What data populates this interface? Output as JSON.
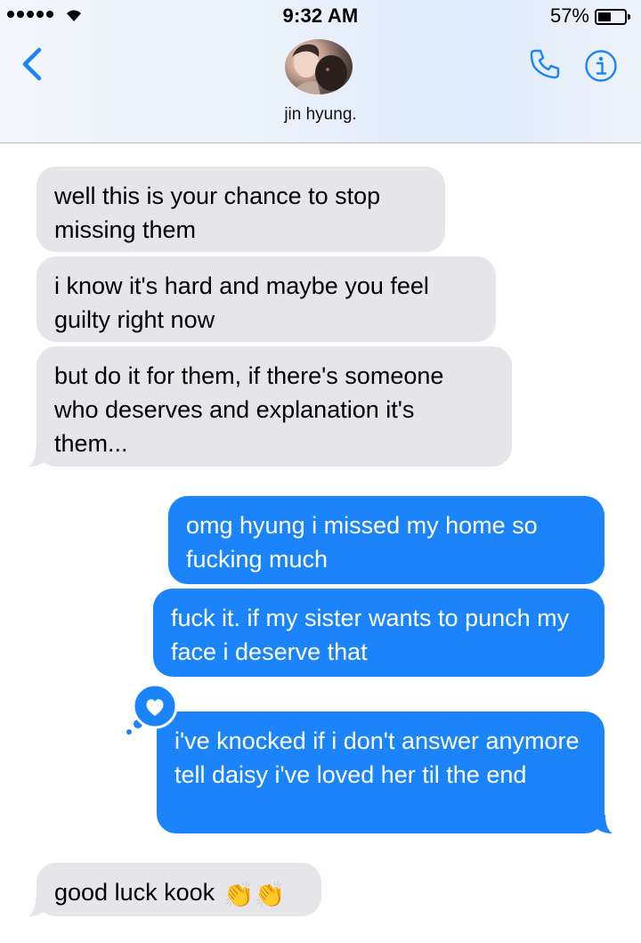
{
  "status_bar": {
    "time": "9:32 AM",
    "battery": "57%",
    "battery_level": 0.57,
    "signal_icon": "signal-dots",
    "wifi_icon": "wifi-icon"
  },
  "header": {
    "contact_name": "jin hyung.",
    "back_icon": "chevron-left-icon",
    "call_icon": "phone-icon",
    "info_icon": "info-icon"
  },
  "messages": [
    {
      "direction": "incoming",
      "text": "well this is your chance to stop missing them"
    },
    {
      "direction": "incoming",
      "text": "i know it's hard and maybe you feel guilty right now"
    },
    {
      "direction": "incoming",
      "text": "but do it for them, if there's someone who deserves and explanation it's them..."
    },
    {
      "direction": "outgoing",
      "text": "omg hyung i missed my home so fucking much"
    },
    {
      "direction": "outgoing",
      "text": "fuck it. if my sister wants to punch my face i deserve that"
    },
    {
      "direction": "outgoing",
      "text": "i've knocked if i don't answer anymore tell daisy i've loved her til the end",
      "reaction": "heart"
    },
    {
      "direction": "incoming",
      "text": "good luck kook",
      "emoji": "👏👏"
    }
  ],
  "colors": {
    "incoming_bubble": "#e5e5ea",
    "outgoing_bubble": "#1b84fb",
    "accent": "#1b84fb"
  }
}
